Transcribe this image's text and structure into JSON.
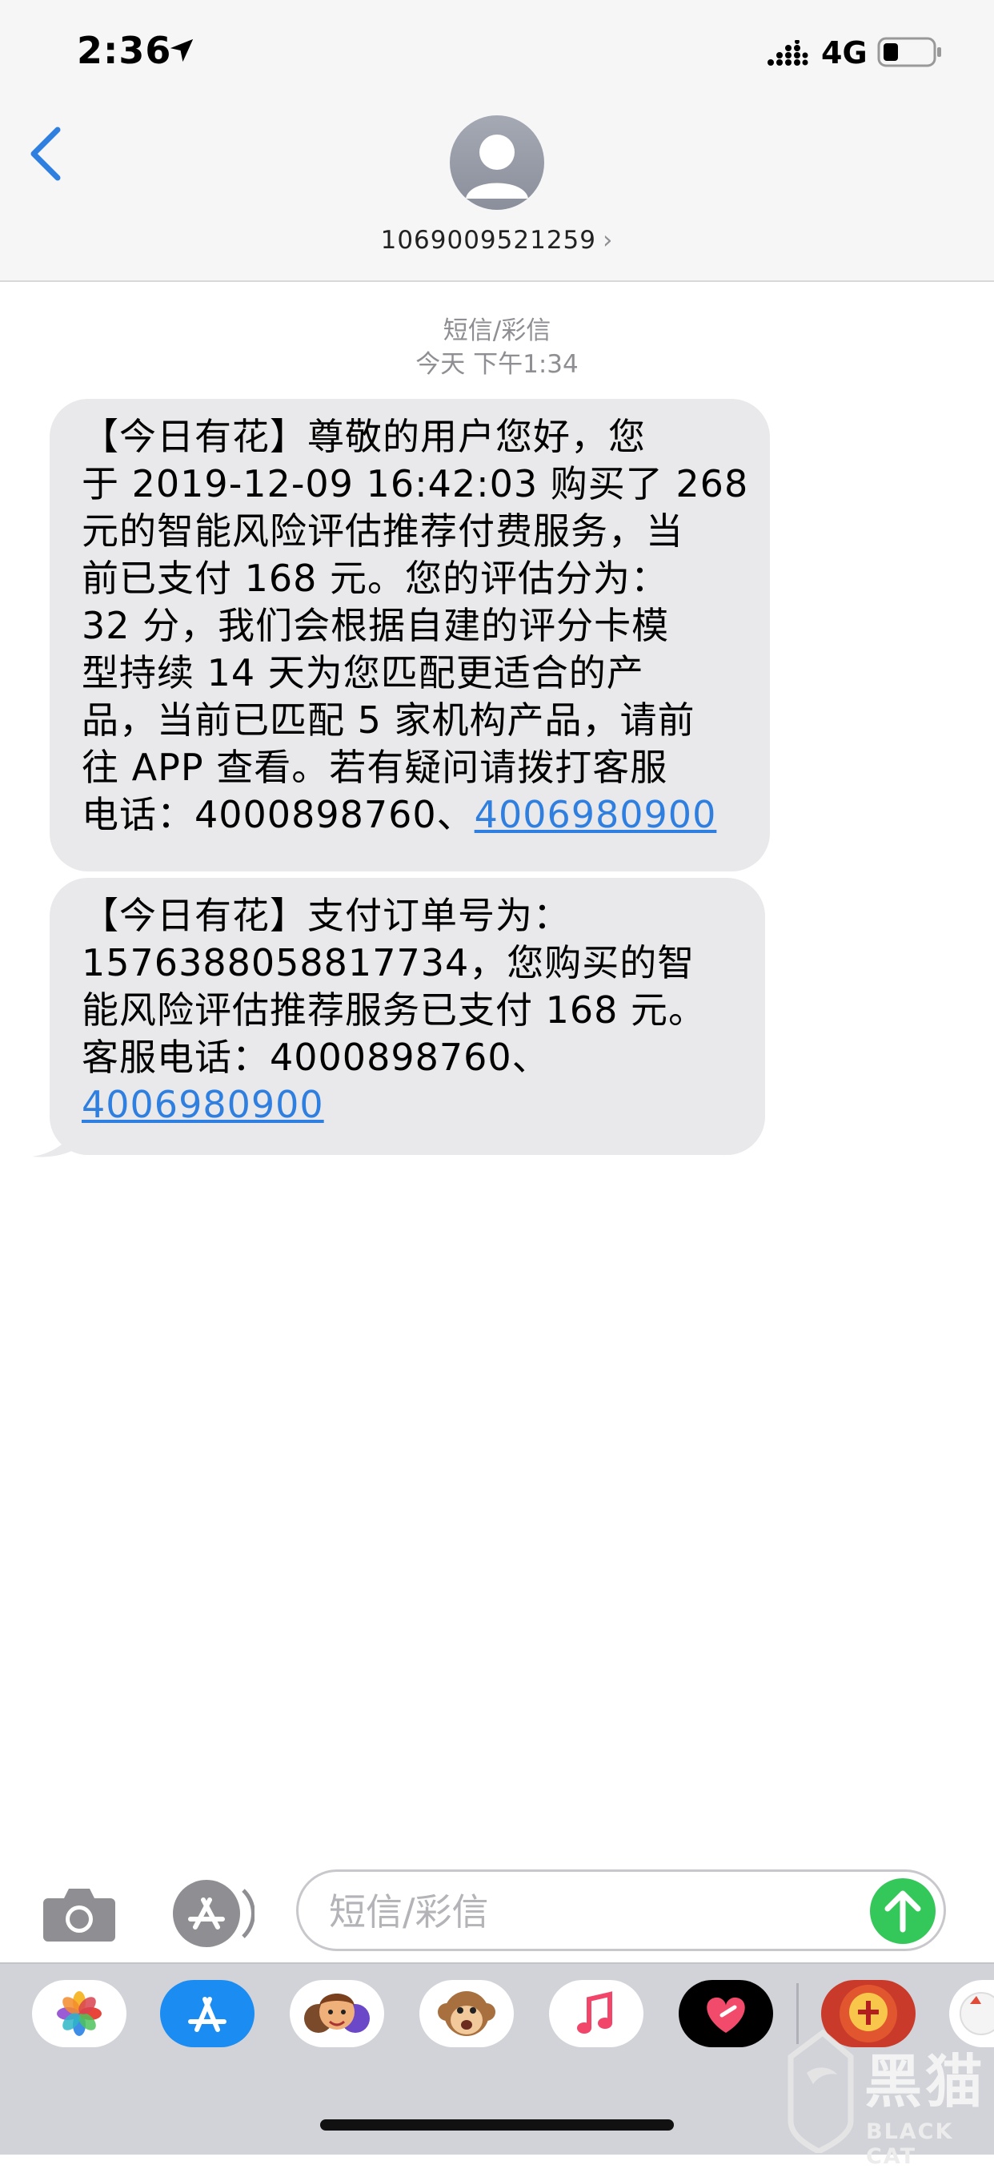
{
  "status_bar": {
    "time": "2:36",
    "network": "4G"
  },
  "contact": {
    "number": "1069009521259",
    "chevron": "›"
  },
  "thread": {
    "type": "短信/彩信",
    "timestamp": "今天 下午1:34"
  },
  "messages": [
    {
      "lines": [
        "【今日有花】尊敬的用户您好，您",
        "于 2019-12-09 16:42:03 购买了 268",
        "元的智能风险评估推荐付费服务，当",
        "前已支付 168 元。您的评估分为：",
        "32 分，我们会根据自建的评分卡模",
        "型持续 14 天为您匹配更适合的产",
        "品，当前已匹配 5 家机构产品，请前",
        "往 APP 查看。若有疑问请拨打客服"
      ],
      "last_prefix": "电话：4000898760、",
      "link": "4006980900"
    },
    {
      "lines": [
        "【今日有花】支付订单号为：",
        "1576388058817734，您购买的智",
        "能风险评估推荐服务已支付 168 元。",
        "客服电话：4000898760、"
      ],
      "link": "4006980900"
    }
  ],
  "compose": {
    "placeholder": "短信/彩信",
    "value": ""
  },
  "icons": {
    "status": [
      "location-arrow-icon",
      "signal-icon",
      "battery-icon"
    ],
    "header": [
      "back-chevron-icon",
      "contact-avatar-icon"
    ],
    "compose": [
      "camera-icon",
      "app-store-icon",
      "send-arrow-icon"
    ],
    "drawer": [
      "photos-app-icon",
      "app-store-app-icon",
      "memoji-app-icon",
      "animoji-app-icon",
      "music-app-icon",
      "digital-touch-app-icon",
      "game-app-icon",
      "sticker-app-icon"
    ]
  },
  "colors": {
    "link": "#2f7fe0",
    "back_button": "#2f7fe0",
    "send_button": "#34c759",
    "bubble": "#e9e9eb",
    "header_bg": "#f6f6f6",
    "drawer_bg": "#d1d3d9"
  },
  "watermark": {
    "text": "黑猫",
    "sub": "BLACK CAT"
  }
}
